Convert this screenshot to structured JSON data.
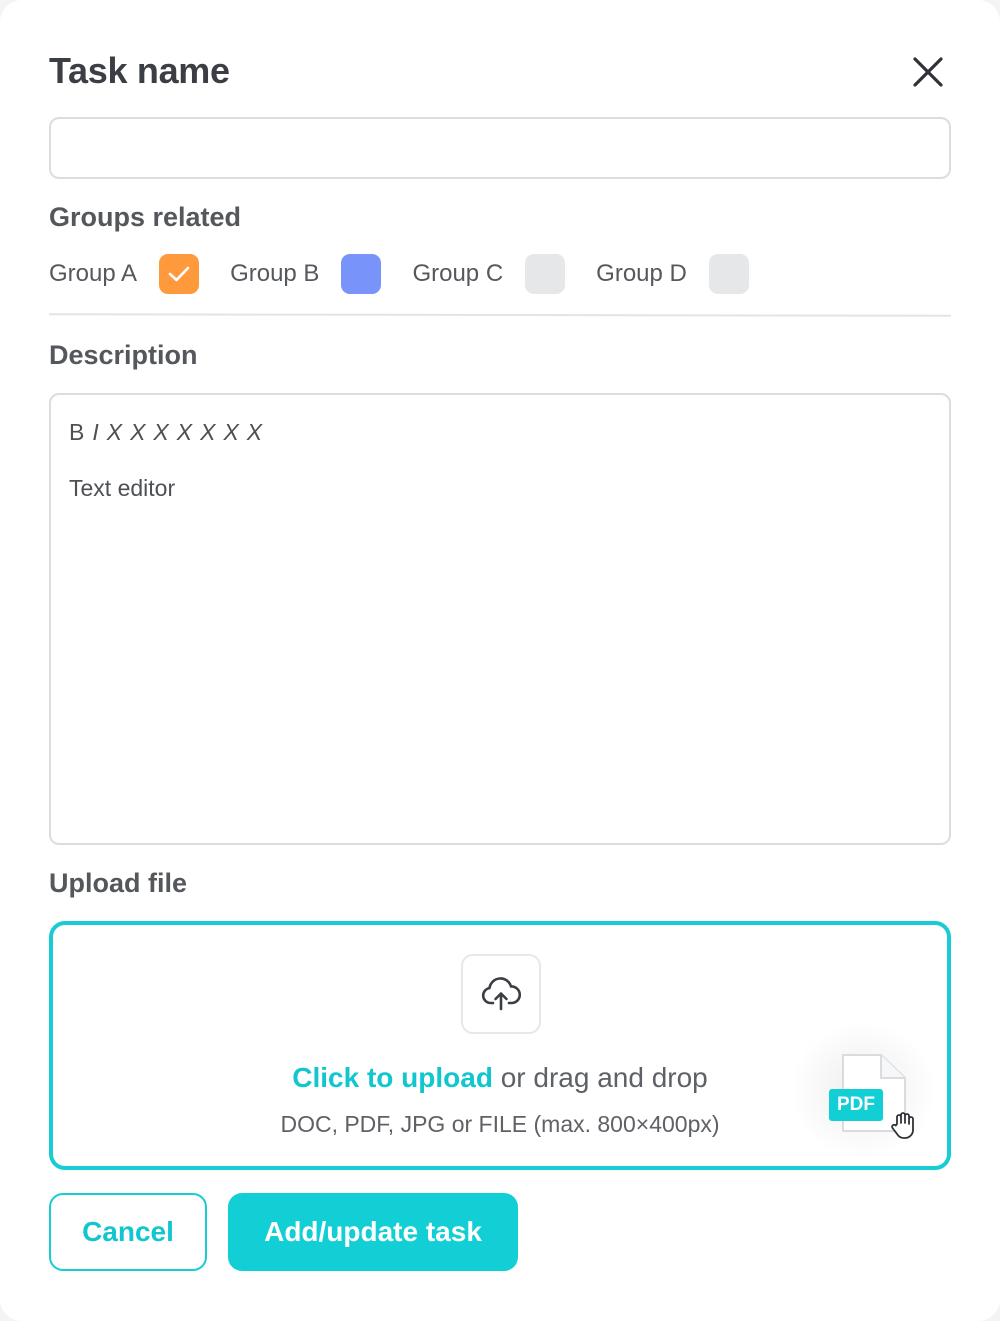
{
  "modal": {
    "title": "Task name",
    "task_name_value": ""
  },
  "groups": {
    "label": "Groups related",
    "items": [
      {
        "label": "Group A",
        "checked": true,
        "color": "#ff9a3c"
      },
      {
        "label": "Group B",
        "checked": false,
        "color": "#7894fb"
      },
      {
        "label": "Group C",
        "checked": false,
        "color": "#e6e7e8"
      },
      {
        "label": "Group D",
        "checked": false,
        "color": "#e6e7e8"
      }
    ]
  },
  "description": {
    "label": "Description",
    "toolbar": [
      "B",
      "I",
      "X",
      "X",
      "X",
      "X",
      "X",
      "X",
      "X"
    ],
    "text": "Text editor"
  },
  "upload": {
    "label": "Upload file",
    "link": "Click to upload",
    "rest": " or drag and drop",
    "hint": "DOC, PDF, JPG or FILE (max. 800×400px)",
    "badge": "PDF"
  },
  "actions": {
    "cancel": "Cancel",
    "submit": "Add/update task"
  },
  "colors": {
    "accent": "#12c6cf",
    "checkbox_checked": "#ff9a3c",
    "group_b": "#7894fb"
  },
  "icons": [
    "close-icon",
    "check-icon",
    "upload-cloud-icon",
    "pdf-file-icon",
    "hand-cursor-icon"
  ]
}
